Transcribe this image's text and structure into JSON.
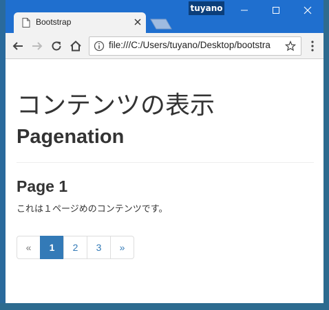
{
  "window": {
    "user_badge": "tuyano",
    "tab_title": "Bootstrap"
  },
  "toolbar": {
    "url": "file:///C:/Users/tuyano/Desktop/bootstra"
  },
  "page": {
    "heading1": "コンテンツの表示",
    "heading2": "Pagenation",
    "heading3": "Page 1",
    "paragraph": "これは１ページめのコンテンツです。"
  },
  "pagination": {
    "prev": "«",
    "pages": [
      "1",
      "2",
      "3"
    ],
    "next": "»",
    "active_page": "1"
  },
  "colors": {
    "accent": "#337ab7",
    "titlebar": "#1f6fcf"
  }
}
